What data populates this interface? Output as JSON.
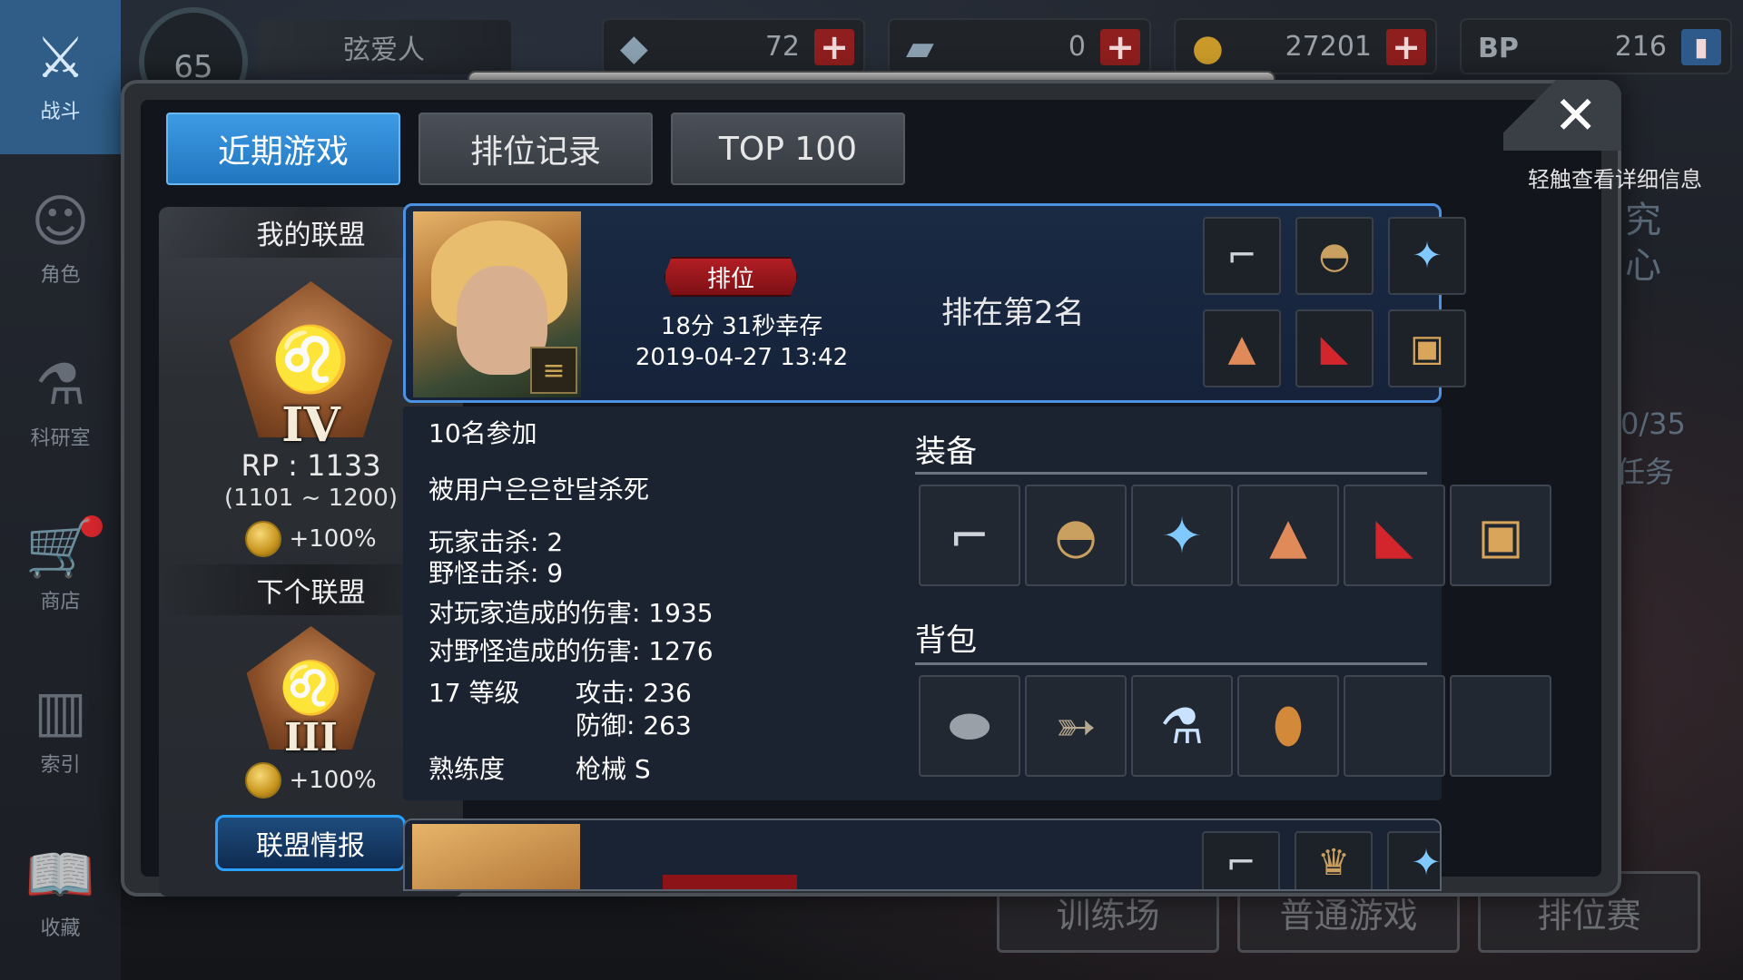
{
  "nav": {
    "items": [
      {
        "label": "战斗",
        "icon": "crossed-guns-icon",
        "glyph": "⚔"
      },
      {
        "label": "角色",
        "icon": "character-icon",
        "glyph": "☺"
      },
      {
        "label": "科研室",
        "icon": "flask-icon",
        "glyph": "⚗"
      },
      {
        "label": "商店",
        "icon": "cart-icon",
        "glyph": "🛒"
      },
      {
        "label": "索引",
        "icon": "books-icon",
        "glyph": "▥"
      },
      {
        "label": "收藏",
        "icon": "open-book-icon",
        "glyph": "📖"
      }
    ]
  },
  "top": {
    "level": "65",
    "player_name": "弦爱人",
    "currencies": [
      {
        "icon": "crystal-icon",
        "value": "72"
      },
      {
        "icon": "ticket-icon",
        "value": "0"
      },
      {
        "icon": "gold-coin-icon",
        "value": "27201"
      },
      {
        "icon": "bp-icon",
        "value": "216"
      }
    ]
  },
  "dialog": {
    "tabs": [
      "近期游戏",
      "排位记录",
      "TOP 100"
    ],
    "active_tab": 0,
    "hint": "轻触查看详细信息",
    "close_glyph": "✕"
  },
  "league": {
    "my_title": "我的联盟",
    "my_tier": "IV",
    "rp": "RP : 1133",
    "range": "(1101 ~ 1200)",
    "bonus": "+100%",
    "next_title": "下个联盟",
    "next_tier": "III",
    "next_bonus": "+100%",
    "info_button": "联盟情报"
  },
  "match": {
    "mode": "排位",
    "survival": "18分 31秒幸存",
    "datetime": "2019-04-27 13:42",
    "rank_text": "排在第2名",
    "participants": "10名参加",
    "killed_by": "被用户은은한달杀死",
    "player_kills": "玩家击杀: 2",
    "monster_kills": "野怪击杀: 9",
    "player_damage": "对玩家造成的伤害: 1935",
    "monster_damage": "对野怪造成的伤害: 1276",
    "level": "17 等级",
    "attack": "攻击: 236",
    "defense": "防御: 263",
    "proficiency_label": "熟练度",
    "proficiency_value": "枪械 S",
    "equipment_label": "装备",
    "backpack_label": "背包",
    "equipment": [
      "pistol-icon",
      "helmet-icon",
      "armor-icon",
      "glove-icon",
      "shoes-icon",
      "box-icon"
    ],
    "backpack": [
      "bullet-icon",
      "fish-icon",
      "flask-icon",
      "potato-icon",
      "",
      ""
    ]
  },
  "background": {
    "modes": [
      "训练场",
      "普通游戏",
      "排位赛"
    ],
    "side_text_1": "究",
    "side_text_2": "心",
    "quest_count": "0/35",
    "quest_label": "任务"
  }
}
